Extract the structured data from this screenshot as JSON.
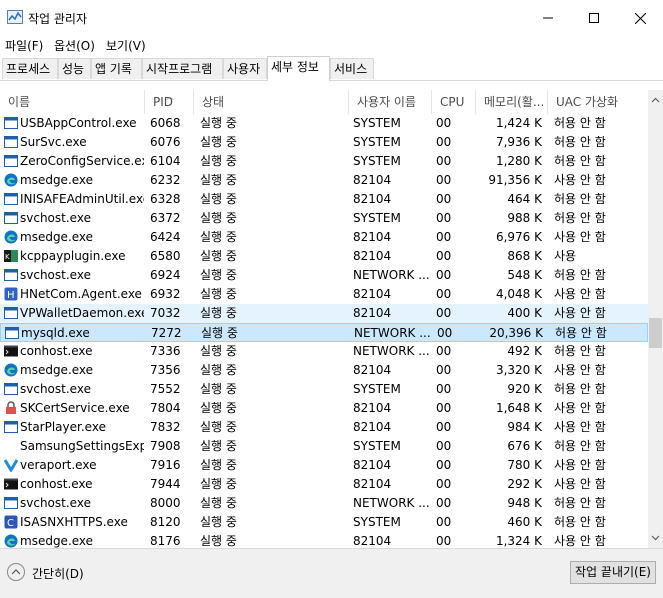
{
  "window": {
    "title": "작업 관리자"
  },
  "menu": [
    "파일(F)",
    "옵션(O)",
    "보기(V)"
  ],
  "tabs": [
    "프로세스",
    "성능",
    "앱 기록",
    "시작프로그램",
    "사용자",
    "세부 정보",
    "서비스"
  ],
  "active_tab": "세부 정보",
  "columns": [
    "이름",
    "PID",
    "상태",
    "사용자 이름",
    "CPU",
    "메모리(활...",
    "UAC 가상화"
  ],
  "rows": [
    {
      "icon": "app-window-icon",
      "name": "USBAppControl.exe",
      "pid": "6068",
      "status": "실행 중",
      "user": "SYSTEM",
      "cpu": "00",
      "mem": "1,424 K",
      "uac": "허용 안 함"
    },
    {
      "icon": "app-window-icon",
      "name": "SurSvc.exe",
      "pid": "6076",
      "status": "실행 중",
      "user": "SYSTEM",
      "cpu": "00",
      "mem": "7,936 K",
      "uac": "허용 안 함"
    },
    {
      "icon": "app-window-icon",
      "name": "ZeroConfigService.exe",
      "pid": "6104",
      "status": "실행 중",
      "user": "SYSTEM",
      "cpu": "00",
      "mem": "1,280 K",
      "uac": "허용 안 함"
    },
    {
      "icon": "edge-icon",
      "name": "msedge.exe",
      "pid": "6232",
      "status": "실행 중",
      "user": "82104",
      "cpu": "00",
      "mem": "91,356 K",
      "uac": "사용 안 함"
    },
    {
      "icon": "app-window-icon",
      "name": "INISAFEAdminUtil.exe",
      "pid": "6328",
      "status": "실행 중",
      "user": "82104",
      "cpu": "00",
      "mem": "464 K",
      "uac": "허용 안 함"
    },
    {
      "icon": "app-window-icon",
      "name": "svchost.exe",
      "pid": "6372",
      "status": "실행 중",
      "user": "SYSTEM",
      "cpu": "00",
      "mem": "988 K",
      "uac": "허용 안 함"
    },
    {
      "icon": "edge-icon",
      "name": "msedge.exe",
      "pid": "6424",
      "status": "실행 중",
      "user": "82104",
      "cpu": "00",
      "mem": "6,976 K",
      "uac": "사용 안 함"
    },
    {
      "icon": "kcp-icon",
      "name": "kcppayplugin.exe",
      "pid": "6580",
      "status": "실행 중",
      "user": "82104",
      "cpu": "00",
      "mem": "868 K",
      "uac": "사용"
    },
    {
      "icon": "app-window-icon",
      "name": "svchost.exe",
      "pid": "6924",
      "status": "실행 중",
      "user": "NETWORK ...",
      "cpu": "00",
      "mem": "548 K",
      "uac": "허용 안 함"
    },
    {
      "icon": "hnet-icon",
      "name": "HNetCom.Agent.exe",
      "pid": "6932",
      "status": "실행 중",
      "user": "82104",
      "cpu": "00",
      "mem": "4,048 K",
      "uac": "사용 안 함"
    },
    {
      "icon": "app-window-icon",
      "name": "VPWalletDaemon.exe",
      "pid": "7032",
      "status": "실행 중",
      "user": "82104",
      "cpu": "00",
      "mem": "400 K",
      "uac": "사용 안 함"
    },
    {
      "icon": "app-window-icon",
      "name": "mysqld.exe",
      "pid": "7272",
      "status": "실행 중",
      "user": "NETWORK ...",
      "cpu": "00",
      "mem": "20,396 K",
      "uac": "허용 안 함"
    },
    {
      "icon": "console-icon",
      "name": "conhost.exe",
      "pid": "7336",
      "status": "실행 중",
      "user": "NETWORK ...",
      "cpu": "00",
      "mem": "492 K",
      "uac": "허용 안 함"
    },
    {
      "icon": "edge-icon",
      "name": "msedge.exe",
      "pid": "7356",
      "status": "실행 중",
      "user": "82104",
      "cpu": "00",
      "mem": "3,320 K",
      "uac": "사용 안 함"
    },
    {
      "icon": "app-window-icon",
      "name": "svchost.exe",
      "pid": "7552",
      "status": "실행 중",
      "user": "SYSTEM",
      "cpu": "00",
      "mem": "920 K",
      "uac": "허용 안 함"
    },
    {
      "icon": "lock-icon",
      "name": "SKCertService.exe",
      "pid": "7804",
      "status": "실행 중",
      "user": "82104",
      "cpu": "00",
      "mem": "1,648 K",
      "uac": "사용 안 함"
    },
    {
      "icon": "app-window-icon",
      "name": "StarPlayer.exe",
      "pid": "7832",
      "status": "실행 중",
      "user": "82104",
      "cpu": "00",
      "mem": "984 K",
      "uac": "사용 안 함"
    },
    {
      "icon": "",
      "name": "SamsungSettingsExp...",
      "pid": "7908",
      "status": "실행 중",
      "user": "SYSTEM",
      "cpu": "00",
      "mem": "676 K",
      "uac": "허용 안 함"
    },
    {
      "icon": "veraport-icon",
      "name": "veraport.exe",
      "pid": "7916",
      "status": "실행 중",
      "user": "82104",
      "cpu": "00",
      "mem": "780 K",
      "uac": "사용 안 함"
    },
    {
      "icon": "console-icon",
      "name": "conhost.exe",
      "pid": "7944",
      "status": "실행 중",
      "user": "82104",
      "cpu": "00",
      "mem": "292 K",
      "uac": "사용 안 함"
    },
    {
      "icon": "app-window-icon",
      "name": "svchost.exe",
      "pid": "8000",
      "status": "실행 중",
      "user": "NETWORK ...",
      "cpu": "00",
      "mem": "948 K",
      "uac": "허용 안 함"
    },
    {
      "icon": "isasn-icon",
      "name": "ISASNXHTTPS.exe",
      "pid": "8120",
      "status": "실행 중",
      "user": "SYSTEM",
      "cpu": "00",
      "mem": "460 K",
      "uac": "허용 안 함"
    },
    {
      "icon": "edge-icon",
      "name": "msedge.exe",
      "pid": "8176",
      "status": "실행 중",
      "user": "82104",
      "cpu": "00",
      "mem": "1,324 K",
      "uac": "사용 안 함"
    }
  ],
  "selected_row": 11,
  "hover_row": 10,
  "footer": {
    "collapse_label": "간단히(D)",
    "end_task_label": "작업 끝내기(E)"
  },
  "colors": {
    "selected_bg": "#cce8ff",
    "hover_bg": "#e5f3ff",
    "edge_blue": "#0f74c8"
  }
}
